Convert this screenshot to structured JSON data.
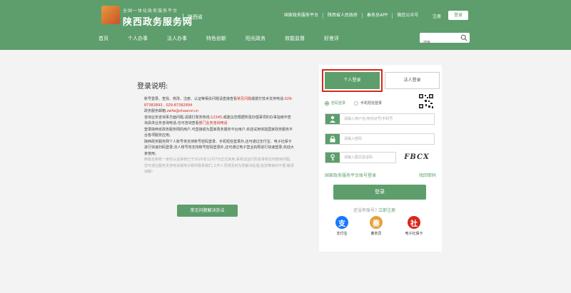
{
  "header": {
    "slogan": "全国一体化政务服务平台",
    "site_title": "陕西政务服务网",
    "region": "陕西省",
    "top_links": [
      "国家政务服务平台",
      "陕西省人民政府",
      "秦务员APP",
      "微信公众号"
    ],
    "register_label": "注册",
    "login_label": "登录"
  },
  "nav": {
    "items": [
      "首页",
      "个人办事",
      "法人办事",
      "特色创新",
      "阳光政务",
      "效能监督",
      "好差评"
    ]
  },
  "search": {
    "placeholder": "搜索"
  },
  "help": {
    "title": "登录说明:",
    "p1_a": "账号登录、查找、修改、注册、认证等相关问题请直接查看",
    "p1_link": "常见问题",
    "p1_b": "或拨打技术支持电话:",
    "p1_phone": "029-87382893、029-87382894",
    "p2_a": "政务服务邮箱:",
    "p2_email": "zwfw@shaanxi.cn",
    "p3_a": "咨询业务咨询事方面问题,请拨打政务热线:",
    "p3_hotline": "12345",
    "p3_b": ",或建议您根据所需办理事项的办事指南中查询具体业务咨询电话,也可咨询查看",
    "p3_link": "部门业务咨询电话",
    "p4": "登录陕西省政务服务网的用户,可直接成为国家政务服务平台用户,欢迎试用体验国家政务服务平台各项服务应用。",
    "p5_a": "陕西政务服务网个人账号将支持账号密码登录、手机短信登录外,还可通过支付宝、电子社保卡进行快速扫码登录;法人账号将支持账号密码登录外,还可通过电子营业执照进行快速登录,欢迎大家使用。",
    "p6": "新版全新统一身份认证系统已于2020年11月7日正式启用,系统试运行阶段将有任何使用问题,您可通过服务支持电话或电子邮件联系我们,工作人员将及时为您解决处理,给您带来的不便,敬请谅解!",
    "faq_button": "常见问题解决办法"
  },
  "login": {
    "tab_personal": "个人登录",
    "tab_legal": "法人登录",
    "radio_password": "密码登录",
    "radio_sms": "手机短信登录",
    "username_placeholder": "请输入用户名/身份证号/手机号",
    "password_placeholder": "请输入密码",
    "captcha_placeholder": "请输入图文验证码",
    "captcha_text": "FBCX",
    "national_link": "国家政务服务平台账号登录",
    "forgot_link": "找回密码",
    "submit": "登录",
    "no_account": "还没有账号?",
    "register_now": "立即注册",
    "alt_logins": [
      {
        "label": "支付宝",
        "color": "#1677ff",
        "glyph": "支"
      },
      {
        "label": "秦务员",
        "color": "#e8a13a",
        "glyph": "秦"
      },
      {
        "label": "电子社保卡",
        "color": "#d9261c",
        "glyph": "社"
      }
    ]
  },
  "colors": {
    "brand_green": "#5d9e6c",
    "alert_red": "#d9261c"
  }
}
